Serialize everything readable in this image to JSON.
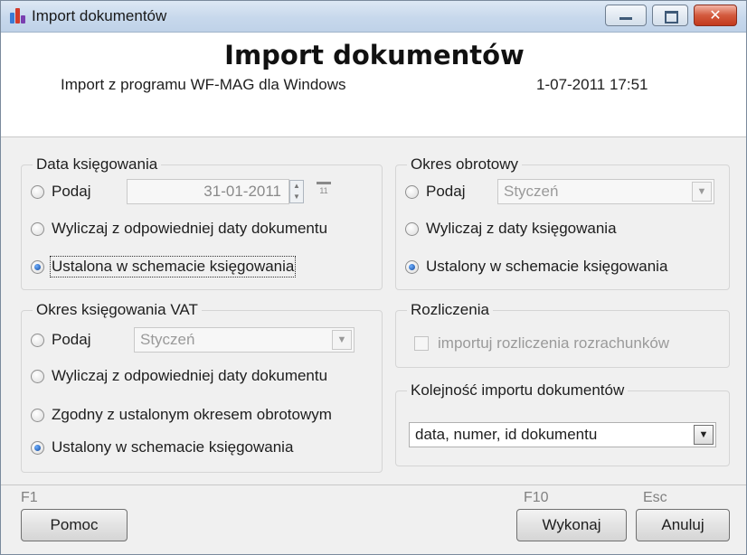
{
  "window": {
    "title": "Import dokumentów",
    "controls": [
      "minimize-icon",
      "maximize-icon",
      "close-icon"
    ]
  },
  "header": {
    "title": "Import dokumentów",
    "source": "Import z programu WF-MAG dla Windows",
    "datetime": "1-07-2011 17:51"
  },
  "data_ksiegowania": {
    "title": "Data księgowania",
    "podaj_label": "Podaj",
    "date_value": "31-01-2011",
    "option_wyliczaj": "Wyliczaj z odpowiedniej daty dokumentu",
    "option_ustalona": "Ustalona w schemacie księgowania",
    "selected": "ustalona",
    "calendar_icon_text": "11"
  },
  "okres_obrotowy": {
    "title": "Okres obrotowy",
    "podaj_label": "Podaj",
    "month_value": "Styczeń",
    "option_wyliczaj": "Wyliczaj z daty księgowania",
    "option_ustalony": "Ustalony w schemacie księgowania",
    "selected": "ustalony"
  },
  "okres_vat": {
    "title": "Okres księgowania VAT",
    "podaj_label": "Podaj",
    "month_value": "Styczeń",
    "option_wyliczaj": "Wyliczaj z odpowiedniej daty dokumentu",
    "option_zgodny": "Zgodny z ustalonym okresem obrotowym",
    "option_ustalony": "Ustalony w schemacie księgowania",
    "selected": "ustalony"
  },
  "rozliczenia": {
    "title": "Rozliczenia",
    "checkbox_label": "importuj rozliczenia rozrachunków",
    "checked": false
  },
  "kolejnosc": {
    "title": "Kolejność importu dokumentów",
    "value": "data, numer, id dokumentu"
  },
  "footer": {
    "f1_label": "F1",
    "help_button": "Pomoc",
    "f10_label": "F10",
    "execute_button": "Wykonaj",
    "esc_label": "Esc",
    "cancel_button": "Anuluj"
  },
  "colors": {
    "title_bar": "#c7d8ec",
    "form_background": "#f0f0f0",
    "radio_selected": "#1f5fbf",
    "close_button": "#c3391c"
  }
}
